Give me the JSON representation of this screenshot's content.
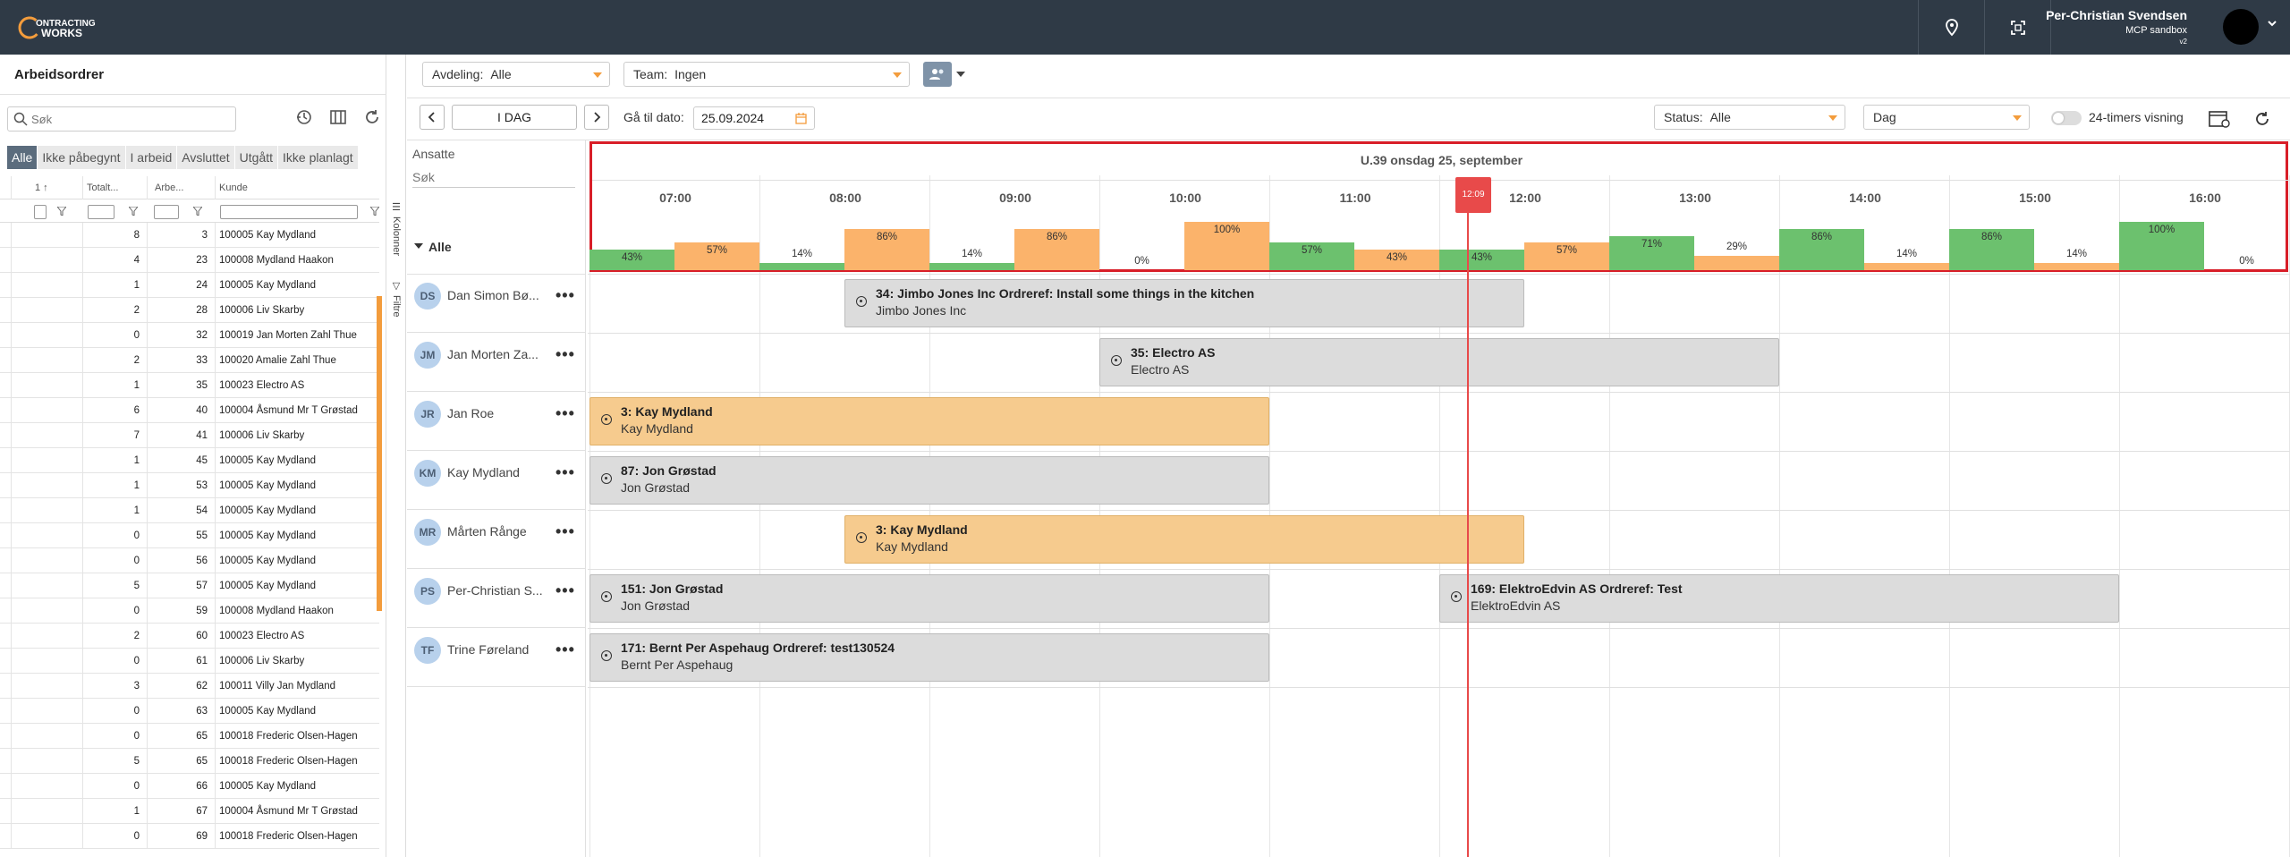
{
  "topbar": {
    "logo_text": [
      "ONTRACTING",
      "WORKS"
    ],
    "user_name": "Per-Christian Svendsen",
    "user_sub": "MCP sandbox",
    "user_version": "v2",
    "icons": [
      "map-pin-icon",
      "fullscreen-icon",
      "chevron-down-icon"
    ]
  },
  "left_panel": {
    "title": "Arbeidsordrer",
    "search_placeholder": "Søk",
    "filter_tabs": [
      "Alle",
      "Ikke påbegynt",
      "I arbeid",
      "Avsluttet",
      "Utgått",
      "Ikke planlagt"
    ],
    "active_tab": "Alle",
    "columns": [
      "1 ↑",
      "Totalt...",
      "Arbe...",
      "Kunde"
    ],
    "rows": [
      {
        "a": "8",
        "b": "3",
        "c": "100005 Kay Mydland"
      },
      {
        "a": "4",
        "b": "23",
        "c": "100008 Mydland Haakon"
      },
      {
        "a": "1",
        "b": "24",
        "c": "100005 Kay Mydland"
      },
      {
        "a": "2",
        "b": "28",
        "c": "100006 Liv Skarby"
      },
      {
        "a": "0",
        "b": "32",
        "c": "100019 Jan Morten Zahl Thue"
      },
      {
        "a": "2",
        "b": "33",
        "c": "100020 Amalie Zahl Thue"
      },
      {
        "a": "1",
        "b": "35",
        "c": "100023 Electro AS"
      },
      {
        "a": "6",
        "b": "40",
        "c": "100004 Åsmund Mr T Grøstad"
      },
      {
        "a": "7",
        "b": "41",
        "c": "100006 Liv Skarby"
      },
      {
        "a": "1",
        "b": "45",
        "c": "100005 Kay Mydland"
      },
      {
        "a": "1",
        "b": "53",
        "c": "100005 Kay Mydland"
      },
      {
        "a": "1",
        "b": "54",
        "c": "100005 Kay Mydland"
      },
      {
        "a": "0",
        "b": "55",
        "c": "100005 Kay Mydland"
      },
      {
        "a": "0",
        "b": "56",
        "c": "100005 Kay Mydland"
      },
      {
        "a": "5",
        "b": "57",
        "c": "100005 Kay Mydland"
      },
      {
        "a": "0",
        "b": "59",
        "c": "100008 Mydland Haakon"
      },
      {
        "a": "2",
        "b": "60",
        "c": "100023 Electro AS"
      },
      {
        "a": "0",
        "b": "61",
        "c": "100006 Liv Skarby"
      },
      {
        "a": "3",
        "b": "62",
        "c": "100011 Villy Jan Mydland"
      },
      {
        "a": "0",
        "b": "63",
        "c": "100005 Kay Mydland"
      },
      {
        "a": "0",
        "b": "65",
        "c": "100018 Frederic Olsen-Hagen"
      },
      {
        "a": "5",
        "b": "65",
        "c": "100018 Frederic Olsen-Hagen"
      },
      {
        "a": "0",
        "b": "66",
        "c": "100005 Kay Mydland"
      },
      {
        "a": "1",
        "b": "67",
        "c": "100004 Åsmund Mr T Grøstad"
      },
      {
        "a": "0",
        "b": "69",
        "c": "100018 Frederic Olsen-Hagen"
      }
    ],
    "side_tabs": [
      "Kolonner",
      "Filtre"
    ]
  },
  "toolbar": {
    "avdeling_label": "Avdeling:",
    "avdeling_value": "Alle",
    "team_label": "Team:",
    "team_value": "Ingen",
    "today_label": "I DAG",
    "goto_label": "Gå til dato:",
    "goto_value": "25.09.2024",
    "status_label": "Status:",
    "status_value": "Alle",
    "view_value": "Dag",
    "toggle_label": "24-timers visning"
  },
  "employees_col": {
    "header": "Ansatte",
    "search_placeholder": "Søk",
    "group_label": "Alle"
  },
  "employees": [
    {
      "initials": "DS",
      "name": "Dan Simon Bø..."
    },
    {
      "initials": "JM",
      "name": "Jan Morten Za..."
    },
    {
      "initials": "JR",
      "name": "Jan Roe"
    },
    {
      "initials": "KM",
      "name": "Kay Mydland"
    },
    {
      "initials": "MR",
      "name": "Mårten Rånge"
    },
    {
      "initials": "PS",
      "name": "Per-Christian S..."
    },
    {
      "initials": "TF",
      "name": "Trine Føreland"
    }
  ],
  "timeline": {
    "week_label": "U.39 onsdag 25, september",
    "hours": [
      "07:00",
      "08:00",
      "09:00",
      "10:00",
      "11:00",
      "12:00",
      "13:00",
      "14:00",
      "15:00",
      "16:00"
    ],
    "now_label": "12:09",
    "utilization": [
      {
        "pct": 43,
        "label": "43%",
        "color": "green"
      },
      {
        "pct": 57,
        "label": "57%",
        "color": "orange"
      },
      {
        "pct": 14,
        "label": "14%",
        "color": "green"
      },
      {
        "pct": 86,
        "label": "86%",
        "color": "orange"
      },
      {
        "pct": 14,
        "label": "14%",
        "color": "green"
      },
      {
        "pct": 86,
        "label": "86%",
        "color": "orange"
      },
      {
        "pct": 0,
        "label": "0%",
        "color": "green"
      },
      {
        "pct": 100,
        "label": "100%",
        "color": "orange"
      },
      {
        "pct": 57,
        "label": "57%",
        "color": "green"
      },
      {
        "pct": 43,
        "label": "43%",
        "color": "orange"
      },
      {
        "pct": 43,
        "label": "43%",
        "color": "green"
      },
      {
        "pct": 57,
        "label": "57%",
        "color": "orange"
      },
      {
        "pct": 71,
        "label": "71%",
        "color": "green"
      },
      {
        "pct": 29,
        "label": "29%",
        "color": "orange"
      },
      {
        "pct": 86,
        "label": "86%",
        "color": "green"
      },
      {
        "pct": 14,
        "label": "14%",
        "color": "orange"
      },
      {
        "pct": 86,
        "label": "86%",
        "color": "green"
      },
      {
        "pct": 14,
        "label": "14%",
        "color": "orange"
      },
      {
        "pct": 100,
        "label": "100%",
        "color": "green"
      },
      {
        "pct": 0,
        "label": "0%",
        "color": "orange"
      }
    ],
    "colors": {
      "green": "#6cc16e",
      "orange": "#fbb36b",
      "frame": "#d81e28",
      "now": "#e84a4a"
    }
  },
  "jobs": [
    {
      "row": 0,
      "start": "08:00",
      "end": "12:00",
      "title": "34: Jimbo Jones Inc Ordreref: Install some things in the kitchen",
      "sub": "Jimbo Jones Inc",
      "style": "grey"
    },
    {
      "row": 1,
      "start": "09:30",
      "end": "13:30",
      "title": "35: Electro AS",
      "sub": "Electro AS",
      "style": "grey"
    },
    {
      "row": 2,
      "start": "06:30",
      "end": "10:30",
      "title": "3: Kay Mydland",
      "sub": "Kay Mydland",
      "style": "orange"
    },
    {
      "row": 3,
      "start": "06:30",
      "end": "10:30",
      "title": "87: Jon Grøstad",
      "sub": "Jon Grøstad",
      "style": "grey"
    },
    {
      "row": 4,
      "start": "08:00",
      "end": "12:00",
      "title": "3: Kay Mydland",
      "sub": "Kay Mydland",
      "style": "orange"
    },
    {
      "row": 5,
      "start": "06:30",
      "end": "10:30",
      "title": "151: Jon Grøstad",
      "sub": "Jon Grøstad",
      "style": "grey"
    },
    {
      "row": 5,
      "start": "11:30",
      "end": "15:30",
      "title": "169: ElektroEdvin AS Ordreref: Test",
      "sub": "ElektroEdvin AS",
      "style": "grey"
    },
    {
      "row": 6,
      "start": "06:30",
      "end": "10:30",
      "title": "171: Bernt Per Aspehaug Ordreref: test130524",
      "sub": "Bernt Per Aspehaug",
      "style": "grey"
    }
  ]
}
